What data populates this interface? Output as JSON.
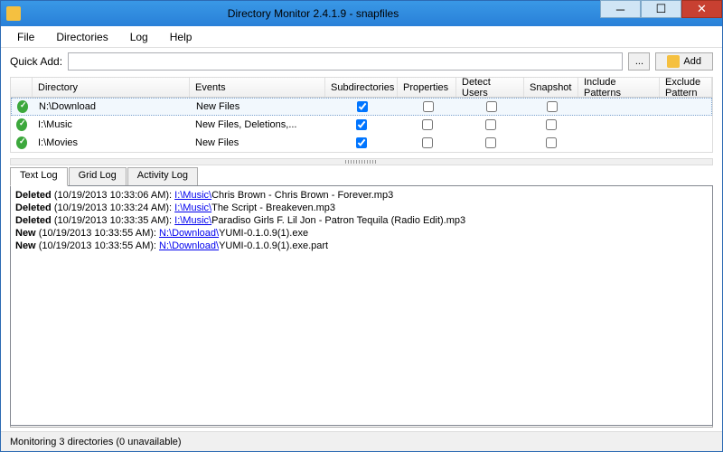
{
  "titlebar": {
    "title": "Directory Monitor 2.4.1.9 - snapfiles"
  },
  "menubar": {
    "items": [
      "File",
      "Directories",
      "Log",
      "Help"
    ]
  },
  "quickadd": {
    "label": "Quick Add:",
    "value": "",
    "browse": "...",
    "add": "Add"
  },
  "columns": {
    "dir": "Directory",
    "events": "Events",
    "sub": "Subdirectories",
    "prop": "Properties",
    "detect": "Detect Users",
    "snap": "Snapshot",
    "inc": "Include Patterns",
    "exc": "Exclude Pattern"
  },
  "rows": [
    {
      "dir": "N:\\Download",
      "events": "New Files",
      "sub": true,
      "prop": false,
      "det": false,
      "snap": false,
      "selected": true
    },
    {
      "dir": "I:\\Music",
      "events": "New Files, Deletions,...",
      "sub": true,
      "prop": false,
      "det": false,
      "snap": false,
      "selected": false
    },
    {
      "dir": "I:\\Movies",
      "events": "New Files",
      "sub": true,
      "prop": false,
      "det": false,
      "snap": false,
      "selected": false
    }
  ],
  "tabs": {
    "items": [
      "Text Log",
      "Grid Log",
      "Activity Log"
    ],
    "active": 0
  },
  "log": [
    {
      "event": "Deleted",
      "time": "(10/19/2013 10:33:06 AM):",
      "path": "I:\\Music\\",
      "file": "Chris Brown - Chris Brown - Forever.mp3"
    },
    {
      "event": "Deleted",
      "time": "(10/19/2013 10:33:24 AM):",
      "path": "I:\\Music\\",
      "file": "The Script - Breakeven.mp3"
    },
    {
      "event": "Deleted",
      "time": "(10/19/2013 10:33:35 AM):",
      "path": "I:\\Music\\",
      "file": "Paradiso Girls F. Lil Jon - Patron Tequila (Radio Edit).mp3"
    },
    {
      "event": "New",
      "time": "(10/19/2013 10:33:55 AM):",
      "path": "N:\\Download\\",
      "file": "YUMI-0.1.0.9(1).exe"
    },
    {
      "event": "New",
      "time": "(10/19/2013 10:33:55 AM):",
      "path": "N:\\Download\\",
      "file": "YUMI-0.1.0.9(1).exe.part"
    }
  ],
  "statusbar": {
    "text": "Monitoring 3 directories (0 unavailable)"
  }
}
